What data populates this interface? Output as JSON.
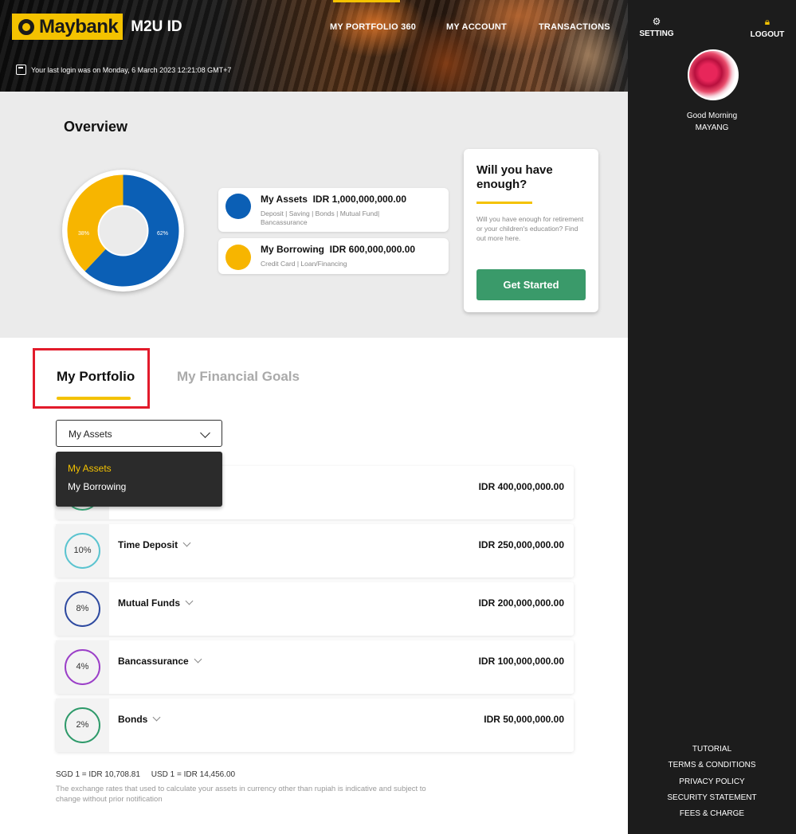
{
  "header": {
    "brand": "Maybank",
    "product": "M2U ID",
    "nav": [
      "MY PORTFOLIO 360",
      "MY ACCOUNT",
      "TRANSACTIONS"
    ],
    "last_login": "Your last login was on Monday, 6 March 2023 12:21:08 GMT+7"
  },
  "sidebar": {
    "setting": "SETTING",
    "logout": "LOGOUT",
    "greeting": "Good Morning",
    "user": "MAYANG",
    "links": [
      "TUTORIAL",
      "TERMS & CONDITIONS",
      "PRIVACY POLICY",
      "SECURITY STATEMENT",
      "FEES & CHARGE"
    ]
  },
  "overview": {
    "title": "Overview",
    "assets_label": "My Assets",
    "assets_amount": "IDR 1,000,000,000.00",
    "assets_sub": "Deposit | Saving | Bonds | Mutual Fund| Bancassurance",
    "borrowing_label": "My Borrowing",
    "borrowing_amount": "IDR 600,000,000.00",
    "borrowing_sub": "Credit Card | Loan/Financing",
    "donut": {
      "assets_pct": 62,
      "borrowing_pct": 38,
      "assets_label": "62%",
      "borrowing_label": "38%"
    }
  },
  "promo": {
    "title": "Will you have enough?",
    "text": "Will you have enough for retirement or your children's education? Find out more here.",
    "button": "Get Started"
  },
  "tabs": [
    "My Portfolio",
    "My Financial Goals"
  ],
  "dropdown": {
    "selected": "My Assets",
    "options": [
      "My Assets",
      "My Borrowing"
    ]
  },
  "assets": [
    {
      "pct": "",
      "name": "",
      "amount": "IDR 400,000,000.00",
      "color": "#3aaa7a"
    },
    {
      "pct": "10%",
      "name": "Time Deposit",
      "amount": "IDR 250,000,000.00",
      "color": "#5bc4d0"
    },
    {
      "pct": "8%",
      "name": "Mutual Funds",
      "amount": "IDR 200,000,000.00",
      "color": "#2e4aa0"
    },
    {
      "pct": "4%",
      "name": "Bancassurance",
      "amount": "IDR 100,000,000.00",
      "color": "#9b3fc8"
    },
    {
      "pct": "2%",
      "name": "Bonds",
      "amount": "IDR 50,000,000.00",
      "color": "#2e9a6a"
    }
  ],
  "fx": {
    "rates": "SGD 1 = IDR 10,708.81     USD 1 = IDR 14,456.00",
    "note": "The exchange rates that used to calculate your assets in currency other than rupiah is indicative and subject to change without prior notification"
  },
  "colors": {
    "brand_yellow": "#f4c200",
    "asset_blue": "#0b5fb5",
    "borrow_yellow": "#f7b500",
    "cta_green": "#3a9a6a",
    "highlight_red": "#e21b2b"
  }
}
